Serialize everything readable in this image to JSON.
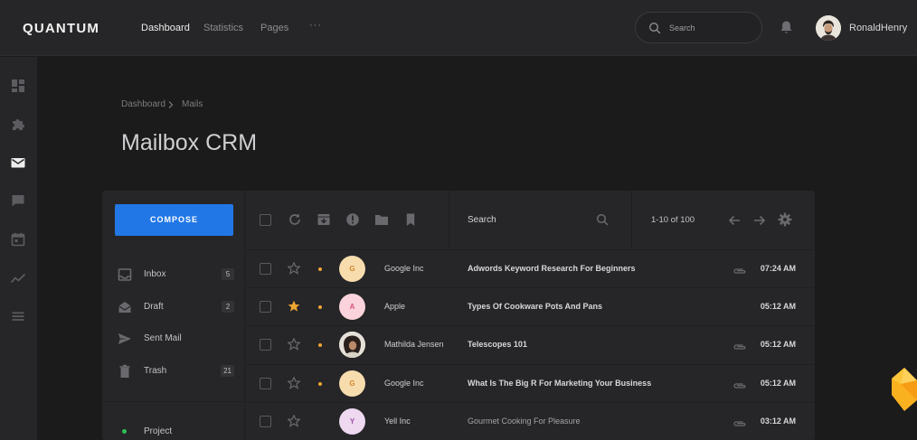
{
  "app": {
    "brand": "QUANTUM"
  },
  "header": {
    "nav": [
      {
        "label": "Dashboard",
        "active": true
      },
      {
        "label": "Statistics",
        "active": false
      },
      {
        "label": "Pages",
        "active": false
      },
      {
        "label": "···",
        "active": false
      }
    ],
    "search": {
      "placeholder": "Search"
    },
    "user": {
      "name": "RonaldHenry"
    }
  },
  "sidebar_icons": [
    "dashboard-icon",
    "puzzle-icon",
    "mail-icon",
    "chat-icon",
    "calendar-icon",
    "trend-icon",
    "menu-icon"
  ],
  "breadcrumb": [
    "Dashboard",
    "Mails"
  ],
  "page_title": "Mailbox CRM",
  "mailbox": {
    "compose_label": "COMPOSE",
    "folders": [
      {
        "label": "Inbox",
        "count": "5",
        "icon": "inbox-icon"
      },
      {
        "label": "Draft",
        "count": "2",
        "icon": "draft-icon"
      },
      {
        "label": "Sent Mail",
        "count": "",
        "icon": "send-icon"
      },
      {
        "label": "Trash",
        "count": "21",
        "icon": "trash-icon"
      }
    ],
    "labels": [
      {
        "label": "Project",
        "color": "#2fbf58"
      }
    ],
    "toolbar": {
      "search_label": "Search",
      "pagination": "1-10 of 100"
    },
    "messages": [
      {
        "starred": false,
        "unread": true,
        "avatar_letter": "G",
        "avatar_bg": "#f7dcae",
        "avatar_fg": "#d4872e",
        "sender": "Google Inc",
        "subject": "Adwords Keyword Research For Beginners",
        "attachment": true,
        "time": "07:24 AM",
        "read": false
      },
      {
        "starred": true,
        "unread": true,
        "avatar_letter": "A",
        "avatar_bg": "#fbd3dc",
        "avatar_fg": "#d7557a",
        "sender": "Apple",
        "subject": "Types Of Cookware Pots And Pans",
        "attachment": false,
        "time": "05:12 AM",
        "read": false
      },
      {
        "starred": false,
        "unread": true,
        "avatar_letter": "",
        "avatar_bg": "#e6e1d8",
        "avatar_fg": "#333333",
        "sender": "Mathilda Jensen",
        "subject": "Telescopes 101",
        "attachment": true,
        "time": "05:12 AM",
        "read": false
      },
      {
        "starred": false,
        "unread": true,
        "avatar_letter": "G",
        "avatar_bg": "#f7dcae",
        "avatar_fg": "#d4872e",
        "sender": "Google Inc",
        "subject": "What Is The Big R For Marketing Your Business",
        "attachment": true,
        "time": "05:12 AM",
        "read": false
      },
      {
        "starred": false,
        "unread": false,
        "avatar_letter": "Y",
        "avatar_bg": "#eed9f1",
        "avatar_fg": "#9a52a8",
        "sender": "Yell Inc",
        "subject": "Gourmet Cooking For Pleasure",
        "attachment": true,
        "time": "03:12 AM",
        "read": true
      }
    ]
  },
  "colors": {
    "accent": "#2277e6",
    "star": "#f0a534",
    "background": "#1b1b1c",
    "surface": "#262628"
  }
}
